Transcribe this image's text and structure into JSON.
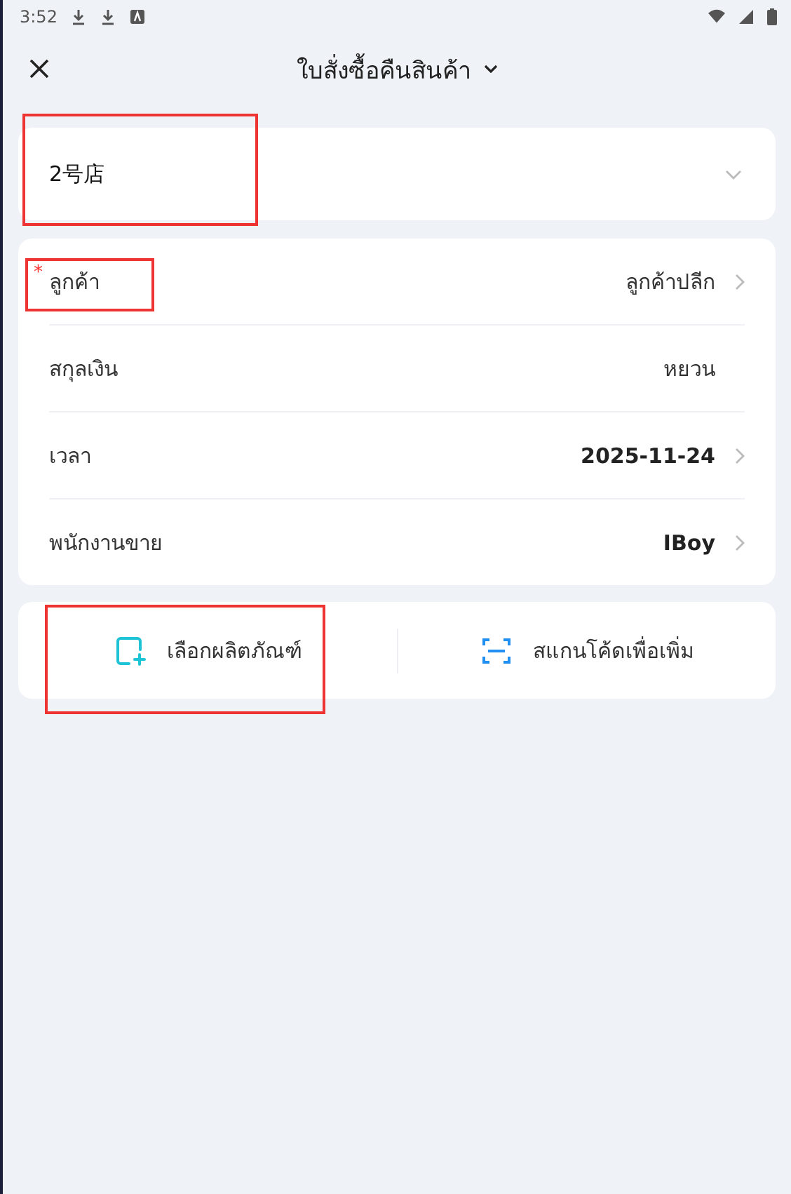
{
  "status_bar": {
    "time": "3:52"
  },
  "header": {
    "title": "ใบสั่งซื้อคืนสินค้า"
  },
  "store": {
    "value": "2号店",
    "highlighted": true
  },
  "fields": [
    {
      "label": "ลูกค้า",
      "value": "ลูกค้าปลีก",
      "marker": "*",
      "bold": false,
      "chevron": true,
      "highlighted": true
    },
    {
      "label": "สกุลเงิน",
      "value": "หยวน",
      "bold": false,
      "chevron": false,
      "highlighted": false
    },
    {
      "label": "เวลา",
      "value": "2025-11-24",
      "bold": true,
      "chevron": true,
      "highlighted": false
    },
    {
      "label": "พนักงานขาย",
      "value": "IBoy",
      "bold": true,
      "chevron": true,
      "highlighted": false
    }
  ],
  "actions": [
    {
      "kind": "select",
      "label": "เลือกผลิตภัณฑ์",
      "highlighted": true
    },
    {
      "kind": "scan",
      "label": "สแกนโค้ดเพื่อเพิ่ม",
      "highlighted": false
    }
  ]
}
